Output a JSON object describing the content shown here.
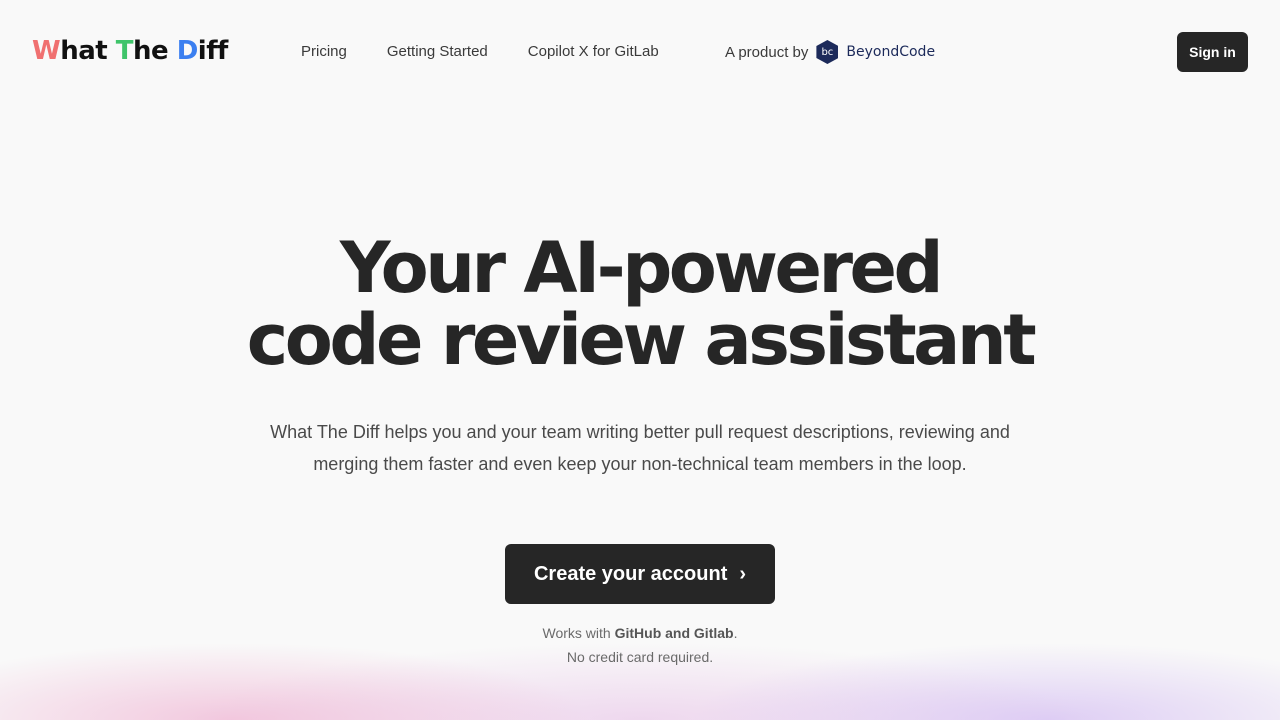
{
  "header": {
    "logo": {
      "w": "W",
      "hat": "hat ",
      "t": "T",
      "he": "he ",
      "d": "D",
      "iff": "iff"
    },
    "nav": [
      "Pricing",
      "Getting Started",
      "Copilot X for GitLab"
    ],
    "product_by": "A product by",
    "brand_mark": "bc",
    "brand_name": "BeyondCode",
    "signin": "Sign in"
  },
  "hero": {
    "title_line1": "Your AI-powered",
    "title_line2": "code review assistant",
    "description": "What The Diff helps you and your team writing better pull request descriptions, reviewing and merging them faster and even keep your non-technical team members in the loop.",
    "cta": "Create your account",
    "cta_icon": "›",
    "works_with_prefix": "Works with ",
    "works_with_bold": "GitHub and Gitlab",
    "works_with_suffix": ".",
    "no_card": "No credit card required."
  }
}
